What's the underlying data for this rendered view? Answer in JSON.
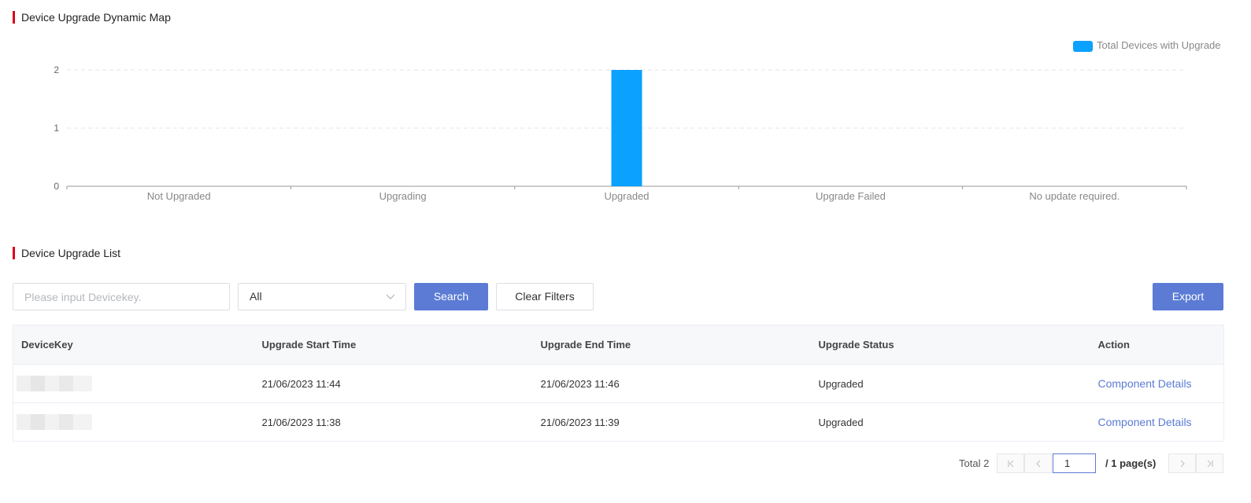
{
  "chart_section": {
    "title": "Device Upgrade Dynamic Map"
  },
  "chart_data": {
    "type": "bar",
    "categories": [
      "Not Upgraded",
      "Upgrading",
      "Upgraded",
      "Upgrade Failed",
      "No update required."
    ],
    "series": [
      {
        "name": "Total Devices with Upgrade",
        "values": [
          0,
          0,
          2,
          0,
          0
        ],
        "color": "#0aa1ff"
      }
    ],
    "ylim": [
      0,
      2
    ],
    "yticks": [
      "0",
      "1",
      "2"
    ],
    "grid": true,
    "legend": "top-right"
  },
  "list_section": {
    "title": "Device Upgrade List"
  },
  "toolbar": {
    "search_placeholder": "Please input Devicekey.",
    "status_select_value": "All",
    "search_label": "Search",
    "clear_label": "Clear Filters",
    "export_label": "Export"
  },
  "table": {
    "columns": [
      "DeviceKey",
      "Upgrade Start Time",
      "Upgrade End Time",
      "Upgrade Status",
      "Action"
    ],
    "rows": [
      {
        "start": "21/06/2023 11:44",
        "end": "21/06/2023 11:46",
        "status": "Upgraded",
        "action": "Component Details"
      },
      {
        "start": "21/06/2023 11:38",
        "end": "21/06/2023 11:39",
        "status": "Upgraded",
        "action": "Component Details"
      }
    ]
  },
  "pagination": {
    "total_label": "Total 2",
    "current_page": "1",
    "pages_label": "/ 1 page(s)",
    "icons": {
      "first": "first-page-icon",
      "prev": "prev-page-icon",
      "next": "next-page-icon",
      "last": "last-page-icon"
    }
  }
}
